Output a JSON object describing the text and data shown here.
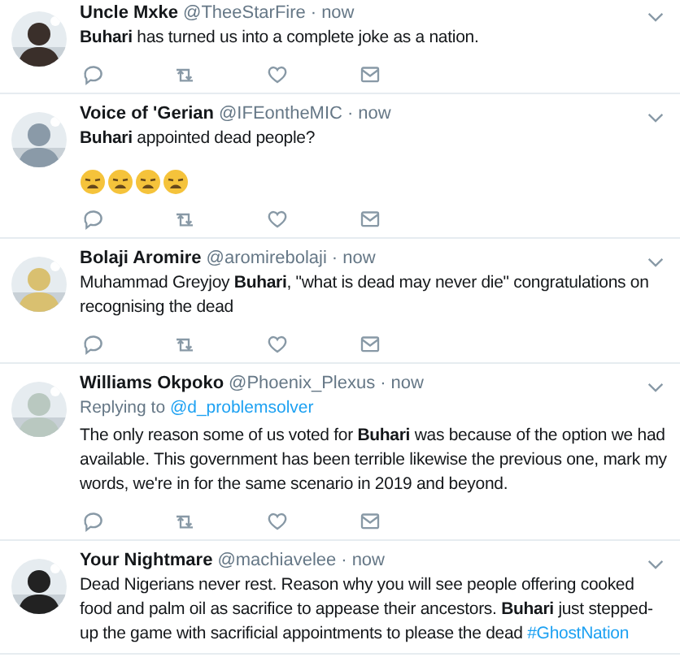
{
  "separator": "·",
  "tweets": [
    {
      "name": "Uncle Mxke",
      "handle": "@TheeStarFire",
      "time": "now",
      "text": [
        {
          "kind": "plain",
          "text": "**Buhari** has turned us into a complete joke as a nation."
        }
      ],
      "actions": [
        {
          "kind": "reply"
        },
        {
          "kind": "retweet"
        },
        {
          "kind": "like"
        },
        {
          "kind": "dm"
        }
      ]
    },
    {
      "name": "Voice of 'Gerian",
      "handle": "@IFEontheMIC",
      "time": "now",
      "text": [
        {
          "kind": "plain",
          "text": "**Buhari** appointed dead people?"
        }
      ],
      "reactions": [
        {
          "kind": "weary-face"
        },
        {
          "kind": "weary-face"
        },
        {
          "kind": "weary-face"
        },
        {
          "kind": "weary-face"
        }
      ],
      "actions": [
        {
          "kind": "reply"
        },
        {
          "kind": "retweet"
        },
        {
          "kind": "like"
        },
        {
          "kind": "dm"
        }
      ]
    },
    {
      "name": "Bolaji Aromire",
      "handle": "@aromirebolaji",
      "time": "now",
      "text": [
        {
          "kind": "plain",
          "text": "Muhammad Greyjoy **Buhari**, \"what is dead may never die\" congratulations on recognising the dead"
        }
      ],
      "actions": [
        {
          "kind": "reply"
        },
        {
          "kind": "retweet"
        },
        {
          "kind": "like"
        },
        {
          "kind": "dm"
        }
      ]
    },
    {
      "name": "Williams Okpoko",
      "handle": "@Phoenix_Plexus",
      "time": "now",
      "replying_label": "Replying to",
      "replying_to": "@d_problemsolver",
      "text": [
        {
          "kind": "plain",
          "text": "The only reason some of us voted for **Buhari** was because of the option we had available. This government has been terrible likewise the previous one, mark my words, we're in for the same scenario in 2019 and beyond."
        }
      ],
      "actions": [
        {
          "kind": "reply"
        },
        {
          "kind": "retweet"
        },
        {
          "kind": "like"
        },
        {
          "kind": "dm"
        }
      ]
    },
    {
      "name": "Your Nightmare",
      "handle": "@machiavelee",
      "time": "now",
      "text": [
        {
          "kind": "plain",
          "text": "Dead Nigerians never rest. Reason why you will see people offering cooked food and palm oil as sacrifice to appease their ancestors. **Buhari** just stepped-up the game with sacrificial appointments to please the dead "
        },
        {
          "kind": "link",
          "text": "#GhostNation"
        }
      ]
    }
  ]
}
